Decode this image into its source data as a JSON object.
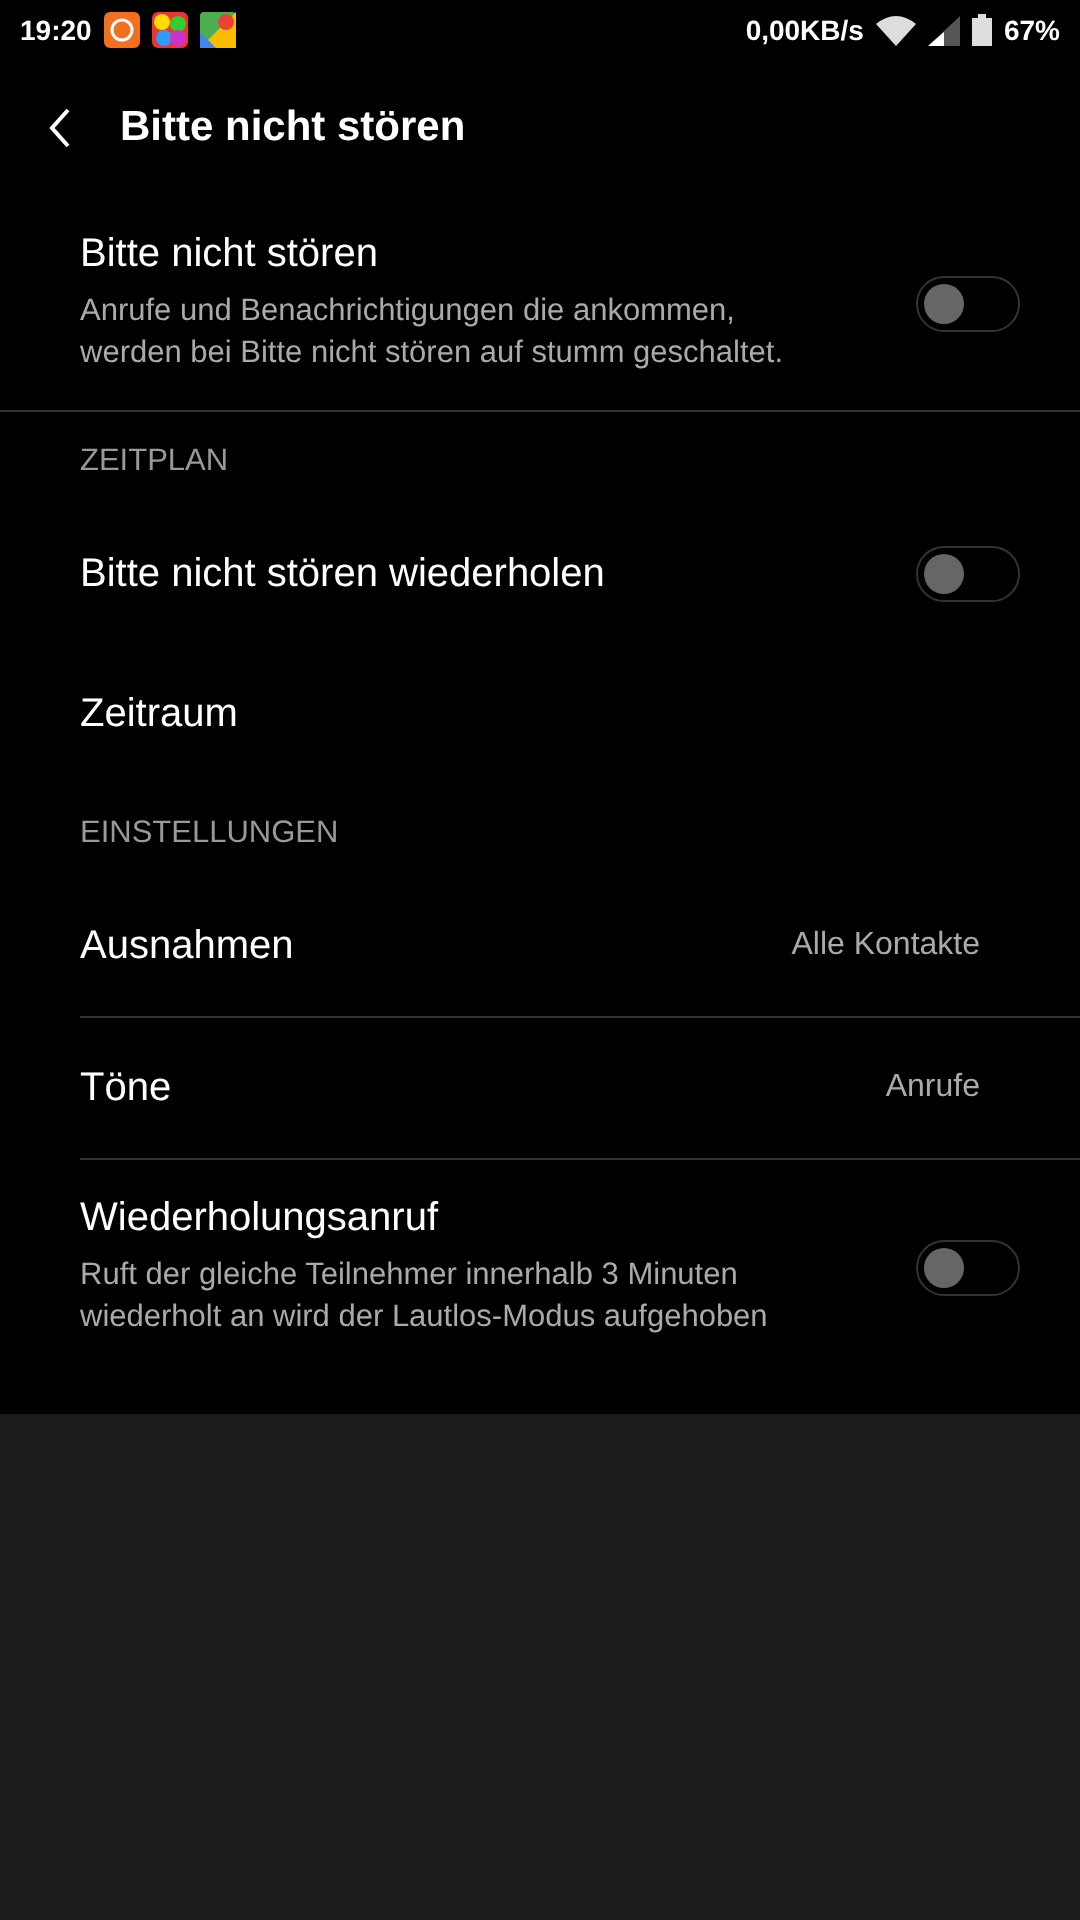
{
  "status_bar": {
    "time": "19:20",
    "speed": "0,00KB/s",
    "battery": "67%"
  },
  "header": {
    "title": "Bitte nicht stören"
  },
  "sections": [
    {
      "items": [
        {
          "kind": "toggle",
          "title": "Bitte nicht stören",
          "description": "Anrufe und Benachrichtigungen die ankommen, werden bei Bitte nicht stören auf stumm geschaltet.",
          "on": false
        }
      ]
    },
    {
      "header": "ZEITPLAN",
      "items": [
        {
          "kind": "toggle",
          "title": "Bitte nicht stören wiederholen",
          "on": false
        },
        {
          "kind": "link",
          "title": "Zeitraum"
        }
      ]
    },
    {
      "header": "EINSTELLUNGEN",
      "divided": true,
      "items": [
        {
          "kind": "value",
          "title": "Ausnahmen",
          "value": "Alle Kontakte"
        },
        {
          "kind": "value",
          "title": "Töne",
          "value": "Anrufe"
        },
        {
          "kind": "toggle",
          "title": "Wiederholungsanruf",
          "description": "Ruft der gleiche Teilnehmer innerhalb 3 Minuten wiederholt an wird der Lautlos-Modus aufgehoben",
          "on": false
        }
      ]
    }
  ]
}
